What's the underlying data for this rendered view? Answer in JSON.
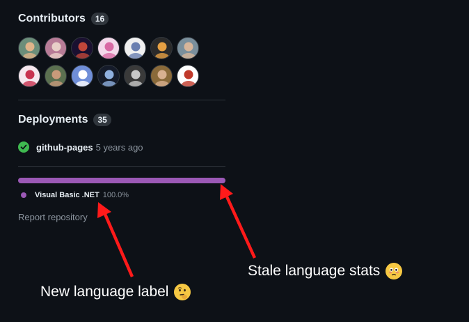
{
  "contributors": {
    "title": "Contributors",
    "count": "16",
    "avatars": [
      {
        "name": "avatar-1",
        "bg": "#6b8e7a",
        "fg": "#e0b48a"
      },
      {
        "name": "avatar-2",
        "bg": "#b77c97",
        "fg": "#e8d0c8"
      },
      {
        "name": "avatar-3",
        "bg": "#1a1030",
        "fg": "#c0463a"
      },
      {
        "name": "avatar-4",
        "bg": "#f3d9ea",
        "fg": "#d86aa4"
      },
      {
        "name": "avatar-5",
        "bg": "#f0f0f0",
        "fg": "#6a7fb0"
      },
      {
        "name": "avatar-6",
        "bg": "#2a2a2a",
        "fg": "#e6a043"
      },
      {
        "name": "avatar-7",
        "bg": "#7a8f9c",
        "fg": "#d7b59a"
      },
      {
        "name": "avatar-8",
        "bg": "#f6e7ee",
        "fg": "#c8324f"
      },
      {
        "name": "avatar-9",
        "bg": "#5b7050",
        "fg": "#c89a7a"
      },
      {
        "name": "avatar-10",
        "bg": "#6f8ed8",
        "fg": "#ffffff"
      },
      {
        "name": "avatar-11",
        "bg": "#151b2a",
        "fg": "#8fb0e0"
      },
      {
        "name": "avatar-12",
        "bg": "#3a3a3a",
        "fg": "#c8c8c8"
      },
      {
        "name": "avatar-13",
        "bg": "#8a6a3a",
        "fg": "#d8b090"
      },
      {
        "name": "avatar-14",
        "bg": "#ffffff",
        "fg": "#c0392b"
      }
    ]
  },
  "deployments": {
    "title": "Deployments",
    "count": "35",
    "item": {
      "name": "github-pages",
      "time": "5 years ago"
    }
  },
  "languages": {
    "name": "Visual Basic .NET",
    "percent": "100.0%",
    "fraction": 1.0,
    "color": "#9b59b6"
  },
  "report": {
    "label": "Report repository"
  },
  "annotations": {
    "left": "New language label",
    "right": "Stale language stats",
    "arrow_color": "#ff1a1a"
  }
}
